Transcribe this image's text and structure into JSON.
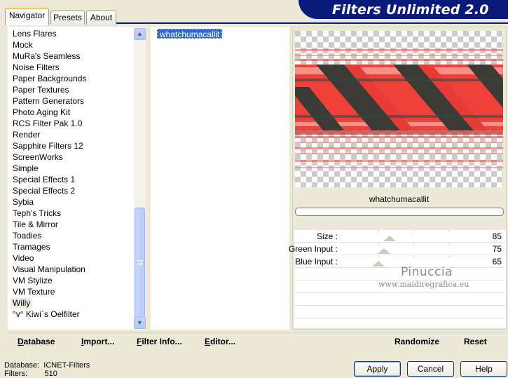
{
  "tabs": [
    "Navigator",
    "Presets",
    "About"
  ],
  "banner_title": "Filters Unlimited 2.0",
  "categories": [
    "Lens Flares",
    "Mock",
    "MuRa's Seamless",
    "Noise Filters",
    "Paper Backgrounds",
    "Paper Textures",
    "Pattern Generators",
    "Photo Aging Kit",
    "RCS Filter Pak 1.0",
    "Render",
    "Sapphire Filters 12",
    "ScreenWorks",
    "Simple",
    "Special Effects 1",
    "Special Effects 2",
    "Sybia",
    "Teph's Tricks",
    "Tile & Mirror",
    "Toadies",
    "Tramages",
    "Video",
    "Visual Manipulation",
    "VM Stylize",
    "VM Texture",
    "Willy",
    "°v° Kiwi`s Oelfilter"
  ],
  "selected_category": "Willy",
  "filters": [
    "whatchumacallit"
  ],
  "preview_label": "whatchumacallit",
  "sliders": [
    {
      "label": "Size :",
      "value": "85"
    },
    {
      "label": "Green Input :",
      "value": "75"
    },
    {
      "label": "Blue Input :",
      "value": "65"
    }
  ],
  "slider_levels": [
    0.33,
    0.29,
    0.25
  ],
  "watermark": {
    "line1": "Pinuccia",
    "line2": "www.maidiregrafica.eu"
  },
  "left_buttons": [
    {
      "label": "Database",
      "underline": "D"
    },
    {
      "label": "Import...",
      "underline": "I"
    },
    {
      "label": "Filter Info...",
      "underline": "F"
    },
    {
      "label": "Editor...",
      "underline": "E"
    }
  ],
  "right_buttons": [
    "Randomize",
    "Reset"
  ],
  "status": {
    "database_label": "Database:",
    "database_value": "ICNET-Filters",
    "filters_label": "Filters:",
    "filters_value": "510"
  },
  "dialog_buttons": [
    "Apply",
    "Cancel",
    "Help"
  ],
  "colors": {
    "banner": "#0a1a78",
    "selection": "#316ac5",
    "preview_red": "#f0403a",
    "preview_dark": "#3a3a36"
  }
}
